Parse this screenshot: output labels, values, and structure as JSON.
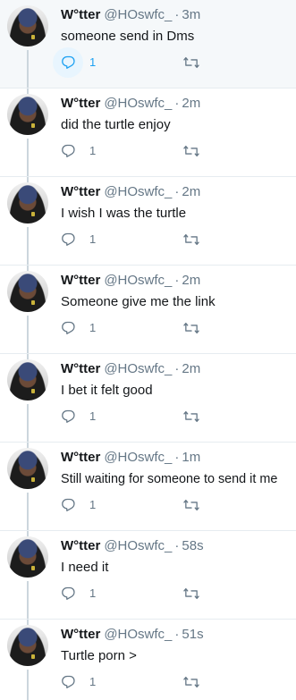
{
  "tweets": [
    {
      "name": "W°tter",
      "handle": "@HOswfc_",
      "time": "3m",
      "text": "someone send in Dms",
      "replies": "1",
      "highlighted": true
    },
    {
      "name": "W°tter",
      "handle": "@HOswfc_",
      "time": "2m",
      "text": "did the turtle enjoy",
      "replies": "1"
    },
    {
      "name": "W°tter",
      "handle": "@HOswfc_",
      "time": "2m",
      "text": "I wish I was the turtle",
      "replies": "1"
    },
    {
      "name": "W°tter",
      "handle": "@HOswfc_",
      "time": "2m",
      "text": "Someone give me the link",
      "replies": "1"
    },
    {
      "name": "W°tter",
      "handle": "@HOswfc_",
      "time": "2m",
      "text": "I bet it felt good",
      "replies": "1"
    },
    {
      "name": "W°tter",
      "handle": "@HOswfc_",
      "time": "1m",
      "text": "Still waiting for someone to send it me",
      "replies": "1"
    },
    {
      "name": "W°tter",
      "handle": "@HOswfc_",
      "time": "58s",
      "text": "I need it",
      "replies": "1"
    },
    {
      "name": "W°tter",
      "handle": "@HOswfc_",
      "time": "51s",
      "text": "Turtle porn >",
      "replies": "1"
    }
  ],
  "separator": "·",
  "icons": {
    "reply": "reply-icon",
    "retweet": "retweet-icon",
    "avatar": "avatar-photo"
  },
  "colors": {
    "accent": "#1da1f2",
    "muted": "#657786",
    "highlight_bg": "#f5f8fa"
  }
}
